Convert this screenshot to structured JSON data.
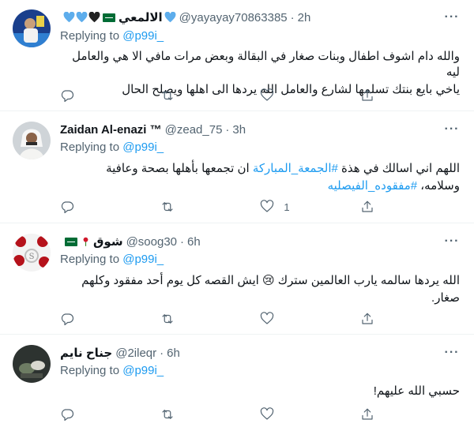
{
  "tweets": [
    {
      "name": "الالمعي",
      "handle": "@yayayay70863385",
      "dot": "·",
      "time": "2h",
      "replying_prefix": "Replying to",
      "replying_to": "@p99i_",
      "body_line1": "والله دام اشوف اطفال وبنات  صغار في البقالة وبعض مرات مافي الا هي والعامل ليه",
      "body_line2": "ياخي بايع بنتك تسلمها لشارع والعامل الله يردها الى اهلها ويصلح الحال",
      "name_emojis": [
        "heart-blue-icon",
        "saudi-flag-icon",
        "heart-black-icon",
        "heart-blue-icon",
        "heart-blue-icon"
      ]
    },
    {
      "name": "Zaidan Al-enazi ™",
      "handle": "@zead_75",
      "dot": "·",
      "time": "3h",
      "replying_prefix": "Replying to",
      "replying_to": "@p99i_",
      "body_line1_pre": "اللهم اني اسالك في هذة ",
      "body_line1_tag": "#الجمعة_المباركة",
      "body_line1_post": " ان تجمعها بأهلها بصحة وعافية",
      "body_line2_pre": "وسلامه، ",
      "body_line2_tag": "#مفقوده_الفيصليه",
      "like_count": "1"
    },
    {
      "name": "شوق",
      "handle": "@soog30",
      "dot": "·",
      "time": "6h",
      "replying_prefix": "Replying to",
      "replying_to": "@p99i_",
      "body_line1": "الله يردها سالمه يارب العالمين سترك 😢 ايش القصه كل يوم أحد مفقود وكلهم",
      "body_line2": "صغار.",
      "name_emojis": [
        "saudi-flag-icon",
        "rose-icon"
      ]
    },
    {
      "name": "جناح نايم",
      "handle": "@2ileqr",
      "dot": "·",
      "time": "6h",
      "replying_prefix": "Replying to",
      "replying_to": "@p99i_",
      "body_line1": "حسبي الله عليهم!"
    }
  ],
  "action_icons": [
    "reply-icon",
    "retweet-icon",
    "like-icon",
    "share-icon"
  ],
  "colors": {
    "link": "#1d9bf0",
    "secondary": "#536471",
    "text": "#0f1419",
    "divider": "#eff3f4"
  }
}
